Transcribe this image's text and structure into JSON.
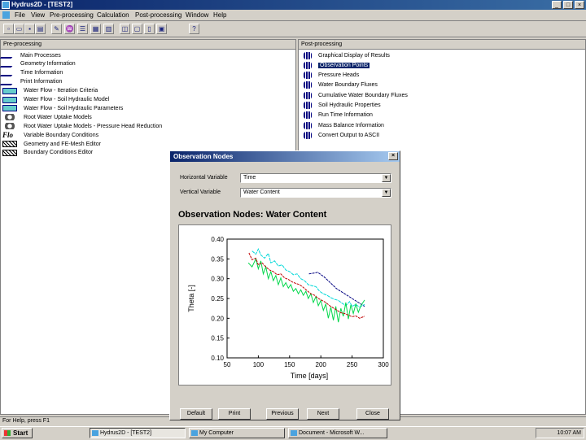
{
  "window": {
    "title": "Hydrus2D - [TEST2]"
  },
  "menu": [
    "File",
    "View",
    "Pre-processing",
    "Calculation",
    "Post-processing",
    "Window",
    "Help"
  ],
  "toolbar_icons": [
    "new-icon",
    "open-icon",
    "save-icon",
    "print-icon",
    "input-icon",
    "run-icon",
    "graph-icon",
    "mesh-icon",
    "post-icon",
    "grid-icon",
    "window-icon",
    "split-icon",
    "help-icon",
    "about-icon"
  ],
  "pre_processing": {
    "header": "Pre-processing",
    "items": [
      {
        "label": "Main Processes",
        "icon": "pen"
      },
      {
        "label": "Geometry Information",
        "icon": "pen"
      },
      {
        "label": "Time Information",
        "icon": "pen"
      },
      {
        "label": "Print Information",
        "icon": "pen"
      },
      {
        "label": "Water Flow - Iteration Criteria",
        "icon": "box"
      },
      {
        "label": "Water Flow - Soil Hydraulic Model",
        "icon": "box"
      },
      {
        "label": "Water Flow - Soil Hydraulic Parameters",
        "icon": "box"
      },
      {
        "label": "Root Water Uptake Models",
        "icon": "gear"
      },
      {
        "label": "Root Water Uptake Models - Pressure Head Reduction",
        "icon": "gear"
      },
      {
        "label": "Variable Boundary Conditions",
        "icon": "flo"
      },
      {
        "label": "Geometry and FE-Mesh Editor",
        "icon": "mesh"
      },
      {
        "label": "Boundary Conditions Editor",
        "icon": "mesh"
      }
    ]
  },
  "post_processing": {
    "header": "Post-processing",
    "items": [
      {
        "label": "Graphical Display of Results"
      },
      {
        "label": "Observation Points"
      },
      {
        "label": "Pressure Heads"
      },
      {
        "label": "Water Boundary Fluxes"
      },
      {
        "label": "Cumulative Water Boundary Fluxes"
      },
      {
        "label": "Soil Hydraulic Properties"
      },
      {
        "label": "Run Time Information"
      },
      {
        "label": "Mass Balance Information"
      },
      {
        "label": "Convert Output to ASCII"
      }
    ],
    "selected": 1
  },
  "status": "For Help, press F1",
  "taskbar": {
    "start": "Start",
    "items": [
      "Hydrus2D - [TEST2]",
      "My Computer",
      "Document - Microsoft W..."
    ],
    "clock": "10:07 AM"
  },
  "dialog": {
    "title": "Observation Nodes",
    "horizontal_label": "Horizontal Variable",
    "horizontal_value": "Time",
    "vertical_label": "Vertical Variable",
    "vertical_value": "Water Content",
    "heading": "Observation Nodes: Water Content",
    "buttons": {
      "default": "Default",
      "print": "Print",
      "previous": "Previous",
      "next": "Next",
      "close": "Close"
    }
  },
  "chart_data": {
    "type": "line",
    "xlabel": "Time [days]",
    "ylabel": "Theta [-]",
    "xlim": [
      50,
      300
    ],
    "ylim": [
      0.1,
      0.4
    ],
    "xticks": [
      "50",
      "100",
      "150",
      "200",
      "250",
      "300"
    ],
    "yticks": [
      "0.10",
      "0.15",
      "0.20",
      "0.25",
      "0.30",
      "0.35",
      "0.40"
    ],
    "grid": false,
    "legend": "none",
    "series": [
      {
        "color": "#000080",
        "x": [
          181,
          195,
          205,
          215,
          225,
          235,
          245,
          255,
          262,
          270
        ],
        "y": [
          0.312,
          0.316,
          0.305,
          0.29,
          0.275,
          0.265,
          0.255,
          0.245,
          0.238,
          0.23
        ]
      },
      {
        "color": "#00d8d8",
        "x": [
          90,
          96,
          100,
          104,
          110,
          116,
          120,
          126,
          132,
          138,
          144,
          150,
          156,
          162,
          168,
          174,
          180,
          186,
          192,
          198,
          204,
          210,
          216,
          222,
          228,
          234,
          240,
          246,
          250,
          256,
          262,
          270
        ],
        "y": [
          0.37,
          0.362,
          0.375,
          0.36,
          0.352,
          0.364,
          0.34,
          0.345,
          0.332,
          0.335,
          0.322,
          0.318,
          0.31,
          0.312,
          0.3,
          0.295,
          0.285,
          0.282,
          0.28,
          0.268,
          0.262,
          0.258,
          0.252,
          0.248,
          0.245,
          0.238,
          0.232,
          0.242,
          0.23,
          0.235,
          0.228,
          0.235
        ]
      },
      {
        "color": "#00d84a",
        "x": [
          84,
          90,
          96,
          100,
          104,
          108,
          112,
          116,
          120,
          124,
          128,
          132,
          136,
          140,
          144,
          148,
          152,
          156,
          160,
          164,
          168,
          172,
          176,
          180,
          184,
          188,
          192,
          196,
          200,
          204,
          208,
          212,
          216,
          220,
          224,
          228,
          232,
          236,
          240,
          244,
          248,
          252,
          256,
          260,
          264,
          270
        ],
        "y": [
          0.34,
          0.33,
          0.35,
          0.325,
          0.345,
          0.312,
          0.33,
          0.3,
          0.318,
          0.295,
          0.308,
          0.285,
          0.302,
          0.28,
          0.29,
          0.276,
          0.285,
          0.268,
          0.275,
          0.262,
          0.272,
          0.258,
          0.268,
          0.25,
          0.262,
          0.24,
          0.255,
          0.232,
          0.245,
          0.22,
          0.236,
          0.2,
          0.228,
          0.195,
          0.23,
          0.19,
          0.225,
          0.205,
          0.24,
          0.198,
          0.234,
          0.212,
          0.236,
          0.215,
          0.232,
          0.246
        ]
      },
      {
        "color": "#c00000",
        "x": [
          85,
          90,
          96,
          100,
          106,
          112,
          118,
          124,
          130,
          136,
          142,
          148,
          154,
          160,
          166,
          172,
          178,
          184,
          190,
          196,
          202,
          208,
          214,
          220,
          226,
          232,
          238,
          244,
          250,
          256,
          262,
          270
        ],
        "y": [
          0.365,
          0.348,
          0.352,
          0.335,
          0.34,
          0.33,
          0.322,
          0.318,
          0.31,
          0.312,
          0.302,
          0.298,
          0.292,
          0.288,
          0.285,
          0.278,
          0.27,
          0.262,
          0.258,
          0.25,
          0.245,
          0.24,
          0.232,
          0.226,
          0.22,
          0.214,
          0.212,
          0.208,
          0.204,
          0.206,
          0.2,
          0.205
        ]
      }
    ]
  }
}
